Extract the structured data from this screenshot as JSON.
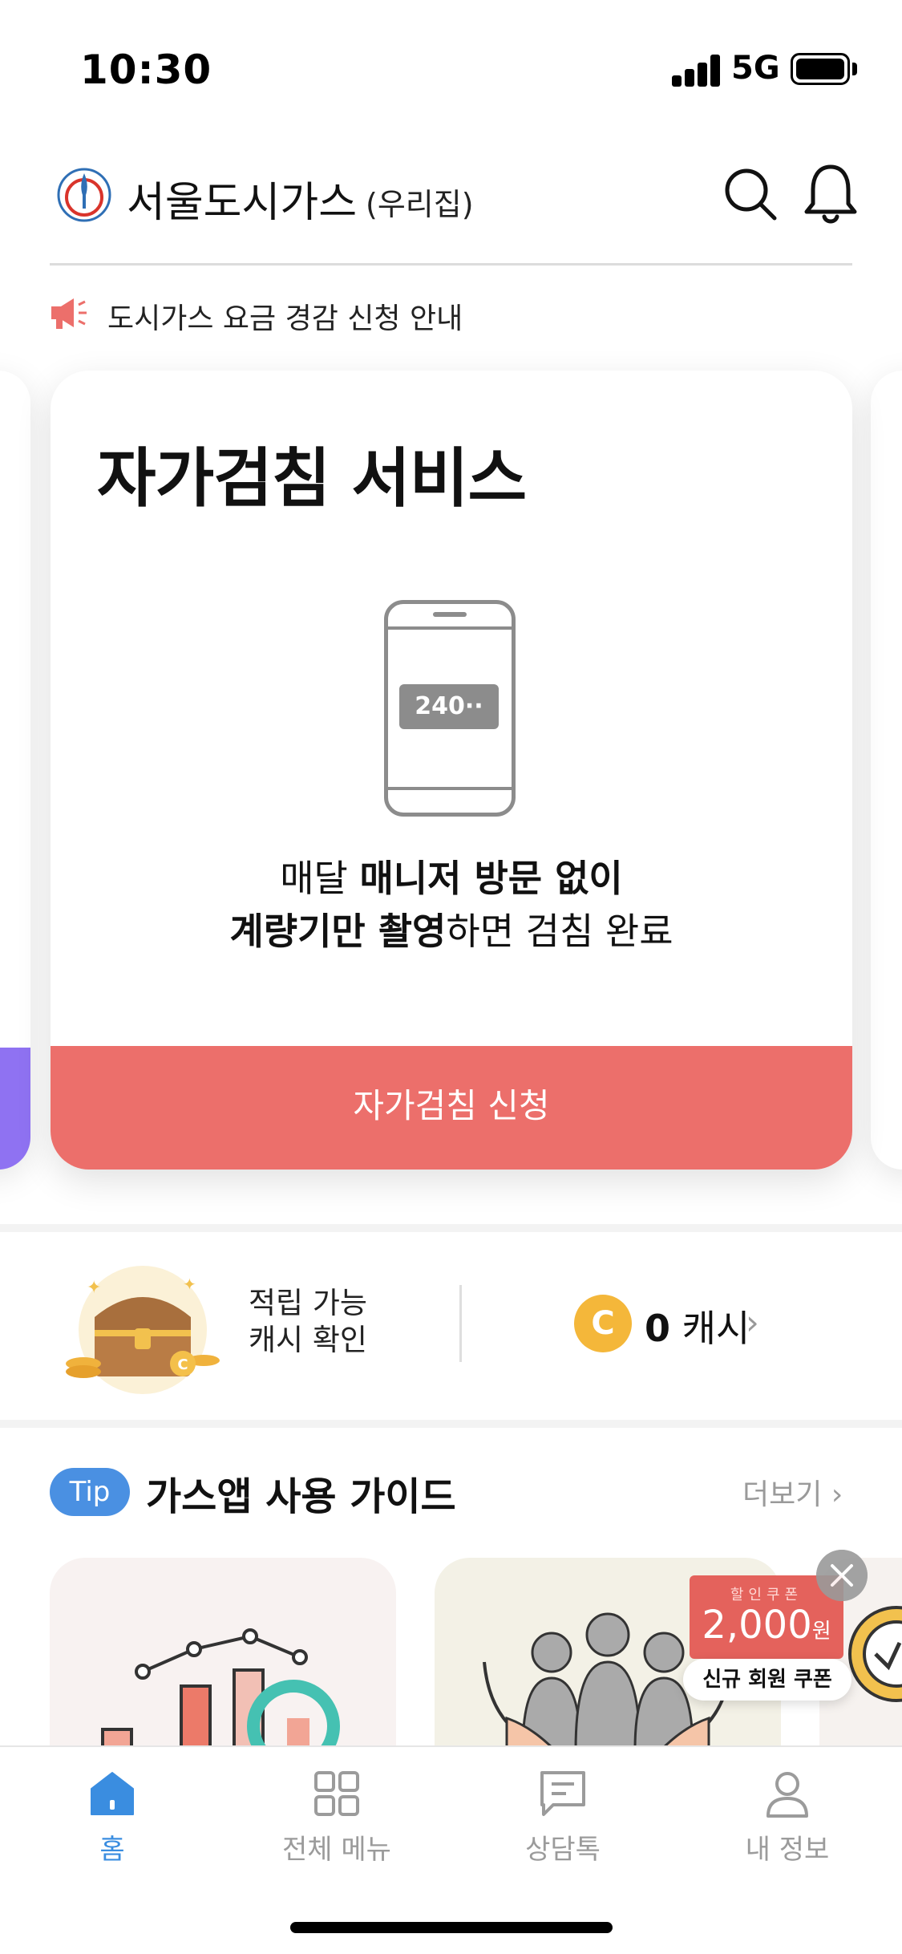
{
  "status_bar": {
    "time": "10:30",
    "network": "5G"
  },
  "header": {
    "title": "서울도시가스",
    "subtitle": "(우리집)"
  },
  "notice": {
    "text": "도시가스 요금 경감 신청 안내"
  },
  "card": {
    "title": "자가검침 서비스",
    "meter_value": "240··",
    "desc_line1_plain": "매달 ",
    "desc_line1_bold": "매니저 방문 없이",
    "desc_line2_bold": "계량기만 촬영",
    "desc_line2_plain": "하면 검침 완료",
    "cta": "자가검침 신청"
  },
  "cash": {
    "label_line1": "적립 가능",
    "label_line2": "캐시 확인",
    "coin_letter": "C",
    "amount": "0",
    "unit": " 캐시"
  },
  "guide": {
    "badge": "Tip",
    "title": "가스앱 사용 가이드",
    "more": "더보기"
  },
  "coupon": {
    "small": "할인쿠폰",
    "amount": "2,000",
    "won": "원",
    "label": "신규 회원 쿠폰"
  },
  "tabs": [
    {
      "label": "홈",
      "icon": "home-icon",
      "active": true
    },
    {
      "label": "전체 메뉴",
      "icon": "grid-icon",
      "active": false
    },
    {
      "label": "상담톡",
      "icon": "chat-icon",
      "active": false
    },
    {
      "label": "내 정보",
      "icon": "person-icon",
      "active": false
    }
  ],
  "colors": {
    "accent_red": "#ec6f6b",
    "accent_blue": "#3a8de0",
    "coin": "#f4b73a",
    "purple": "#8f72f2"
  }
}
